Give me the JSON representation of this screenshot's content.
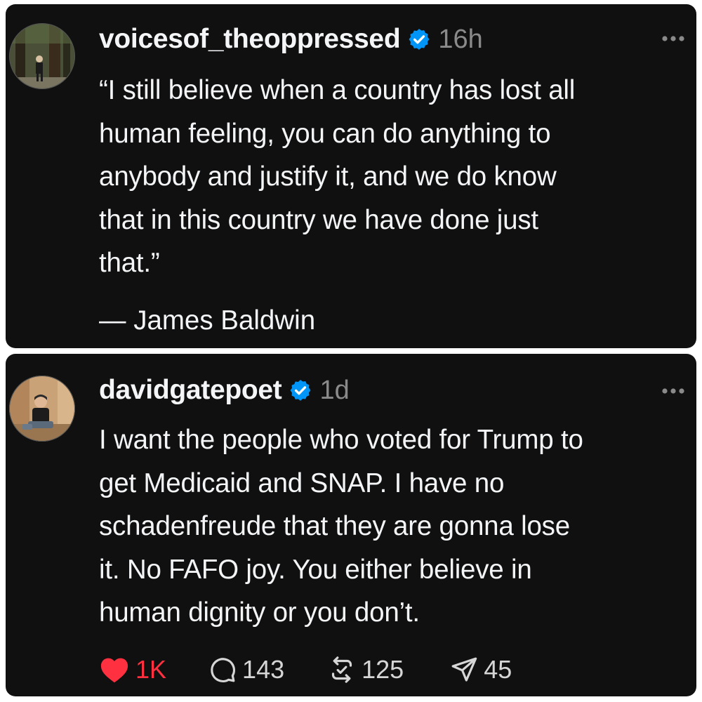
{
  "posts": [
    {
      "username": "voicesof_theoppressed",
      "time": "16h",
      "text": "“I still believe when a country has lost all\nhuman feeling, you can do anything to\nanybody and justify it, and we do know\nthat in this country we have done just\nthat.”",
      "attribution": "— James Baldwin",
      "avatar_icon": "forest-portrait-avatar"
    },
    {
      "username": "davidgatepoet",
      "time": "1d",
      "text": "I want the people who voted for Trump to\nget Medicaid and SNAP. I have no\nschadenfreude that they are gonna lose\nit. No FAFO joy. You either believe in\nhuman dignity or you don’t.",
      "avatar_icon": "seated-man-avatar",
      "actions": {
        "likes": "1K",
        "replies": "143",
        "reposts": "125",
        "shares": "45"
      }
    }
  ],
  "colors": {
    "card_bg": "#101010",
    "text": "#f3f5f7",
    "muted": "#8a8a8a",
    "verified": "#0095f6",
    "like": "#ff3040"
  },
  "icons": [
    "verified-badge-icon",
    "more-options-icon",
    "heart-icon",
    "comment-icon",
    "repost-icon",
    "share-icon"
  ]
}
